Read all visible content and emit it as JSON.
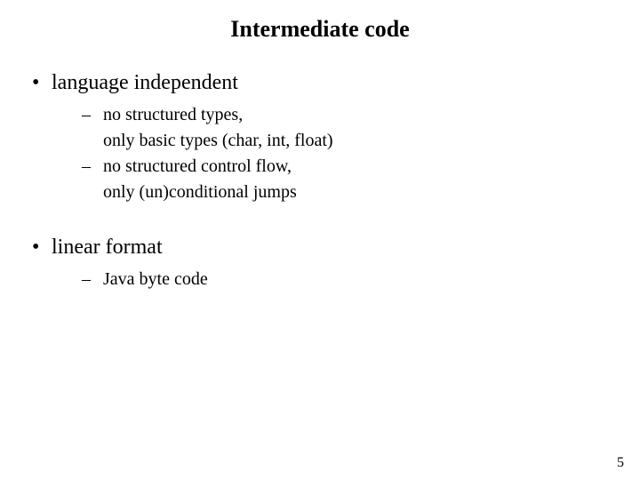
{
  "title": "Intermediate code",
  "bullets": {
    "b1": "language independent",
    "b1_sub1a": "no structured types,",
    "b1_sub1b": "only basic types (char, int, float)",
    "b1_sub2a": "no structured control flow,",
    "b1_sub2b": "only (un)conditional jumps",
    "b2": "linear format",
    "b2_sub1": "Java byte code"
  },
  "page_number": "5"
}
